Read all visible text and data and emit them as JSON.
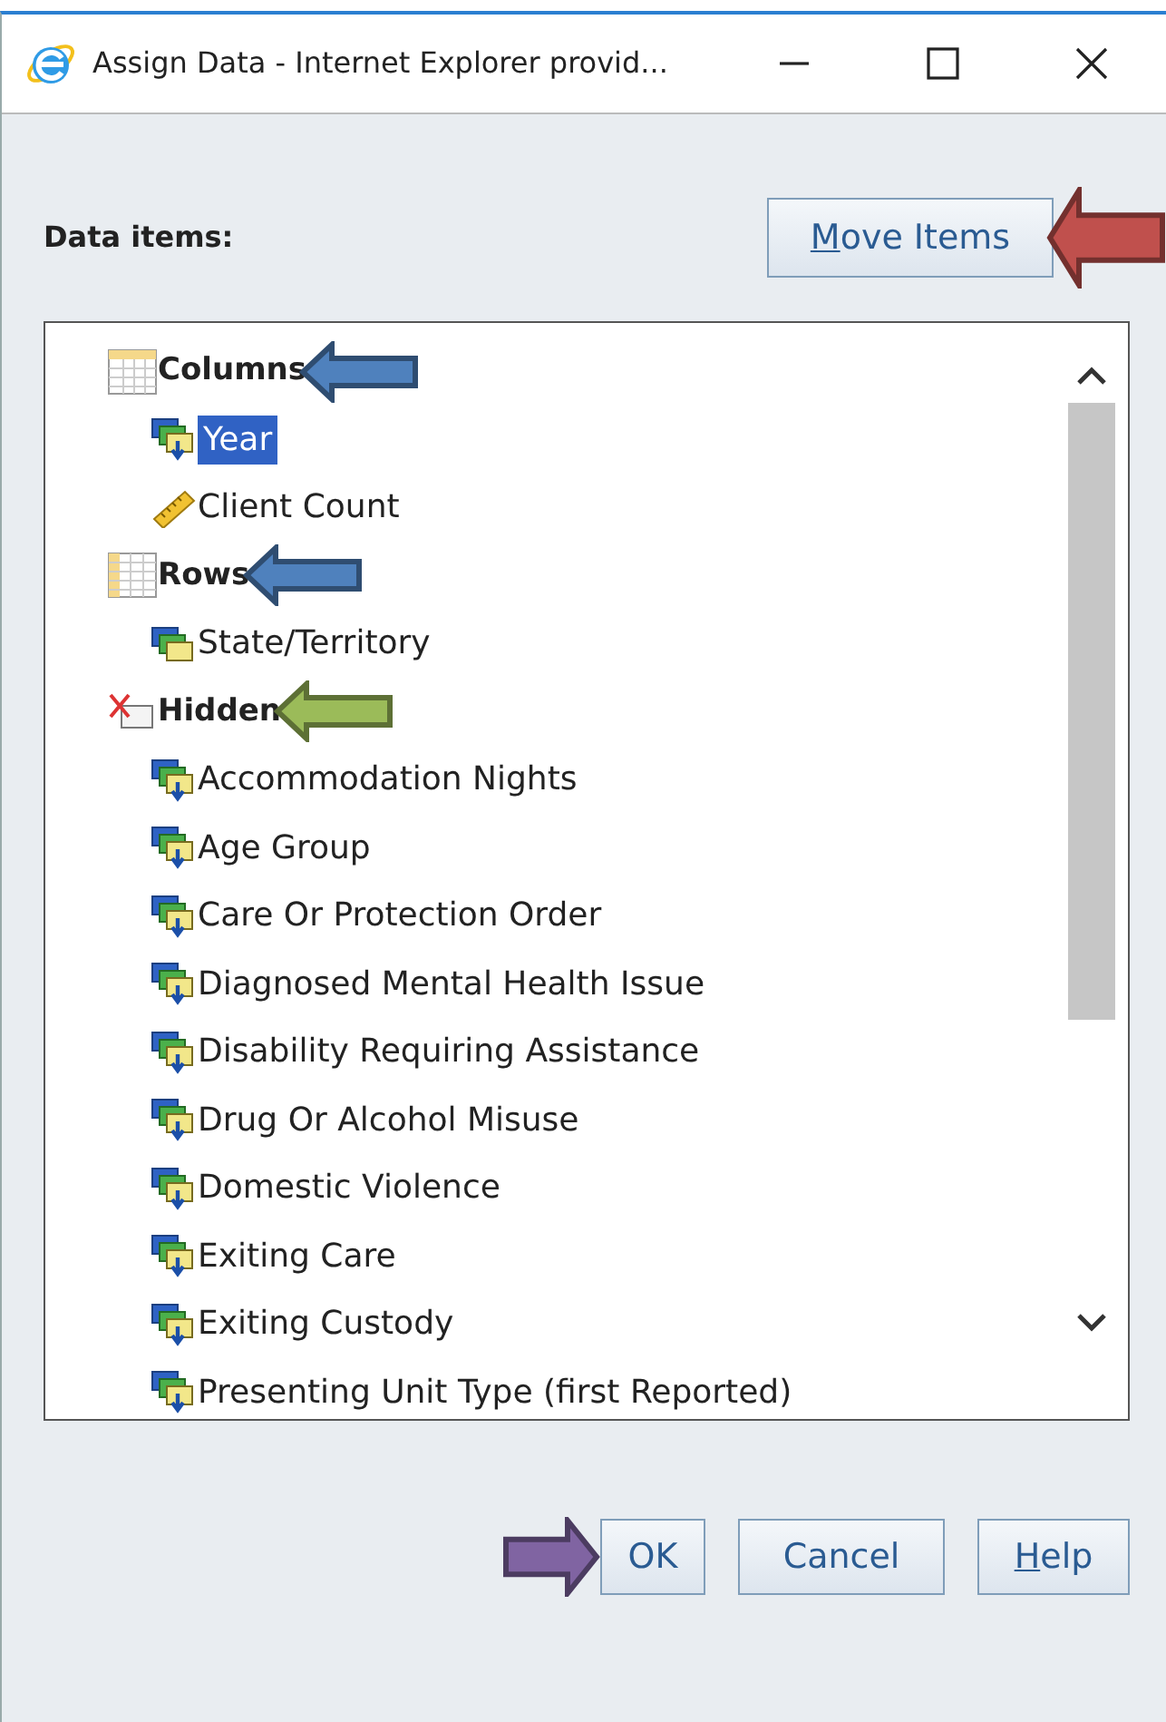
{
  "window": {
    "title": "Assign Data - Internet Explorer provid..."
  },
  "data_items_label": "Data items:",
  "move_items": {
    "access_key": "M",
    "label_rest": "ove Items",
    "annotation": {
      "color": "#c0504d"
    }
  },
  "tree": [
    {
      "label": "Columns",
      "kind": "columns",
      "annotation": {
        "color": "#4f81bd"
      },
      "children": [
        {
          "label": "Year",
          "kind": "category",
          "selected": true
        },
        {
          "label": "Client Count",
          "kind": "measure",
          "selected": false
        }
      ]
    },
    {
      "label": "Rows",
      "kind": "rows",
      "annotation": {
        "color": "#4f81bd"
      },
      "children": [
        {
          "label": "State/Territory",
          "kind": "category_plain",
          "selected": false
        }
      ]
    },
    {
      "label": "Hidden",
      "kind": "hidden",
      "annotation": {
        "color": "#9bbb59"
      },
      "children": [
        {
          "label": "Accommodation Nights",
          "kind": "category",
          "selected": false
        },
        {
          "label": "Age Group",
          "kind": "category",
          "selected": false
        },
        {
          "label": "Care Or Protection Order",
          "kind": "category",
          "selected": false
        },
        {
          "label": "Diagnosed Mental Health Issue",
          "kind": "category",
          "selected": false
        },
        {
          "label": "Disability Requiring Assistance",
          "kind": "category",
          "selected": false
        },
        {
          "label": "Drug Or Alcohol Misuse",
          "kind": "category",
          "selected": false
        },
        {
          "label": "Domestic Violence",
          "kind": "category",
          "selected": false
        },
        {
          "label": "Exiting Care",
          "kind": "category",
          "selected": false
        },
        {
          "label": "Exiting Custody",
          "kind": "category",
          "selected": false
        },
        {
          "label": "Presenting Unit Type (first Reported)",
          "kind": "category",
          "selected": false
        }
      ]
    }
  ],
  "buttons": [
    {
      "label": "OK",
      "annotation": {
        "color": "#8064a2"
      }
    },
    {
      "label": "Cancel"
    },
    {
      "access_key": "H",
      "label_rest": "elp"
    }
  ]
}
